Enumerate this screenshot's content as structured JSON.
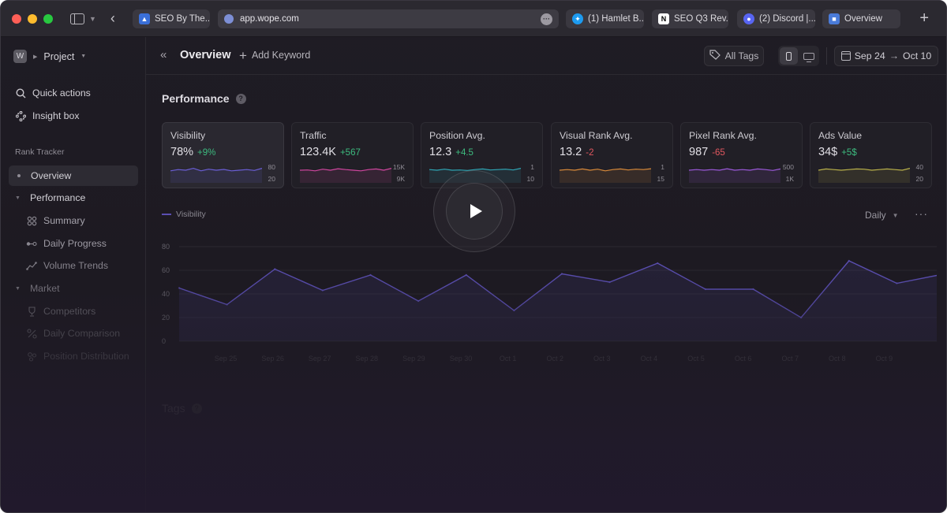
{
  "browser": {
    "tabs": [
      {
        "title": "SEO By The...",
        "icon": "seo-site-icon",
        "color": "#3a6fd8"
      },
      {
        "title": "(1) Hamlet B...",
        "icon": "twitter-icon",
        "color": "#1d9bf0"
      },
      {
        "title": "SEO Q3 Rev...",
        "icon": "notion-icon",
        "color": "#ffffff"
      },
      {
        "title": "(2) Discord |...",
        "icon": "discord-icon",
        "color": "#5865f2"
      },
      {
        "title": "Overview",
        "icon": "wope-icon",
        "color": "#4a7bd9"
      }
    ],
    "url": "app.wope.com",
    "new_tab": "+"
  },
  "sidebar": {
    "workspace_badge": "W",
    "project": "Project",
    "quick_actions": "Quick actions",
    "insight_box": "Insight box",
    "section": "Rank Tracker",
    "items": [
      {
        "label": "Overview"
      },
      {
        "label": "Performance"
      },
      {
        "label": "Summary"
      },
      {
        "label": "Daily Progress"
      },
      {
        "label": "Volume Trends"
      },
      {
        "label": "Market"
      },
      {
        "label": "Competitors"
      },
      {
        "label": "Daily Comparison"
      },
      {
        "label": "Position Distribution"
      }
    ]
  },
  "topbar": {
    "title": "Overview",
    "add_keyword": "Add Keyword",
    "all_tags": "All Tags",
    "date_from": "Sep 24",
    "date_to": "Oct 10",
    "device_selected": "mobile"
  },
  "performance": {
    "title": "Performance",
    "cards": [
      {
        "label": "Visibility",
        "value": "78%",
        "delta": "+9%",
        "trend": "up",
        "hi": "80",
        "lo": "20",
        "color": "#6b5fd6",
        "spark": [
          0.55,
          0.45,
          0.5,
          0.35,
          0.55,
          0.42,
          0.5,
          0.44,
          0.55,
          0.5,
          0.45,
          0.52,
          0.35
        ]
      },
      {
        "label": "Traffic",
        "value": "123.4K",
        "delta": "+567",
        "trend": "up",
        "hi": "15K",
        "lo": "9K",
        "color": "#d0469f",
        "spark": [
          0.5,
          0.48,
          0.55,
          0.42,
          0.5,
          0.38,
          0.45,
          0.5,
          0.55,
          0.45,
          0.4,
          0.5,
          0.35
        ]
      },
      {
        "label": "Position Avg.",
        "value": "12.3",
        "delta": "+4.5",
        "trend": "up",
        "hi": "1",
        "lo": "10",
        "color": "#2fa6b5",
        "spark": [
          0.45,
          0.5,
          0.42,
          0.5,
          0.48,
          0.52,
          0.45,
          0.4,
          0.48,
          0.45,
          0.42,
          0.48,
          0.35
        ]
      },
      {
        "label": "Visual Rank Avg.",
        "value": "13.2",
        "delta": "-2",
        "trend": "down",
        "hi": "1",
        "lo": "15",
        "color": "#d98a3a",
        "spark": [
          0.5,
          0.45,
          0.5,
          0.4,
          0.5,
          0.42,
          0.55,
          0.45,
          0.4,
          0.48,
          0.42,
          0.45,
          0.38
        ]
      },
      {
        "label": "Pixel Rank Avg.",
        "value": "987",
        "delta": "-65",
        "trend": "down",
        "hi": "500",
        "lo": "1K",
        "color": "#9b59d9",
        "spark": [
          0.5,
          0.45,
          0.5,
          0.45,
          0.5,
          0.38,
          0.5,
          0.45,
          0.5,
          0.4,
          0.45,
          0.52,
          0.4
        ]
      },
      {
        "label": "Ads Value",
        "value": "34$",
        "delta": "+5$",
        "trend": "up",
        "hi": "40",
        "lo": "20",
        "color": "#b9b04a",
        "spark": [
          0.5,
          0.4,
          0.45,
          0.5,
          0.45,
          0.4,
          0.42,
          0.5,
          0.45,
          0.4,
          0.45,
          0.5,
          0.35
        ]
      }
    ]
  },
  "chart_data": {
    "type": "area",
    "title": "",
    "series": [
      {
        "name": "Visibility",
        "values": [
          45,
          31,
          61,
          43,
          56,
          34,
          56,
          26,
          57,
          50,
          66,
          44,
          44,
          20,
          68,
          49,
          57
        ]
      }
    ],
    "x": [
      "Sep 25",
      "Sep 26",
      "Sep 27",
      "Sep 28",
      "Sep 29",
      "Sep 30",
      "Oct 1",
      "Oct 2",
      "Oct 3",
      "Oct 4",
      "Oct 5",
      "Oct 6",
      "Oct 7",
      "Oct 8",
      "Oct 9"
    ],
    "y_ticks": [
      "80",
      "60",
      "40",
      "20",
      "0"
    ],
    "ylim": [
      0,
      80
    ],
    "grid": true,
    "interval": "Daily",
    "color": "#5b4fb3"
  },
  "tags": {
    "title": "Tags"
  },
  "video": {
    "play_icon": "play-icon"
  }
}
